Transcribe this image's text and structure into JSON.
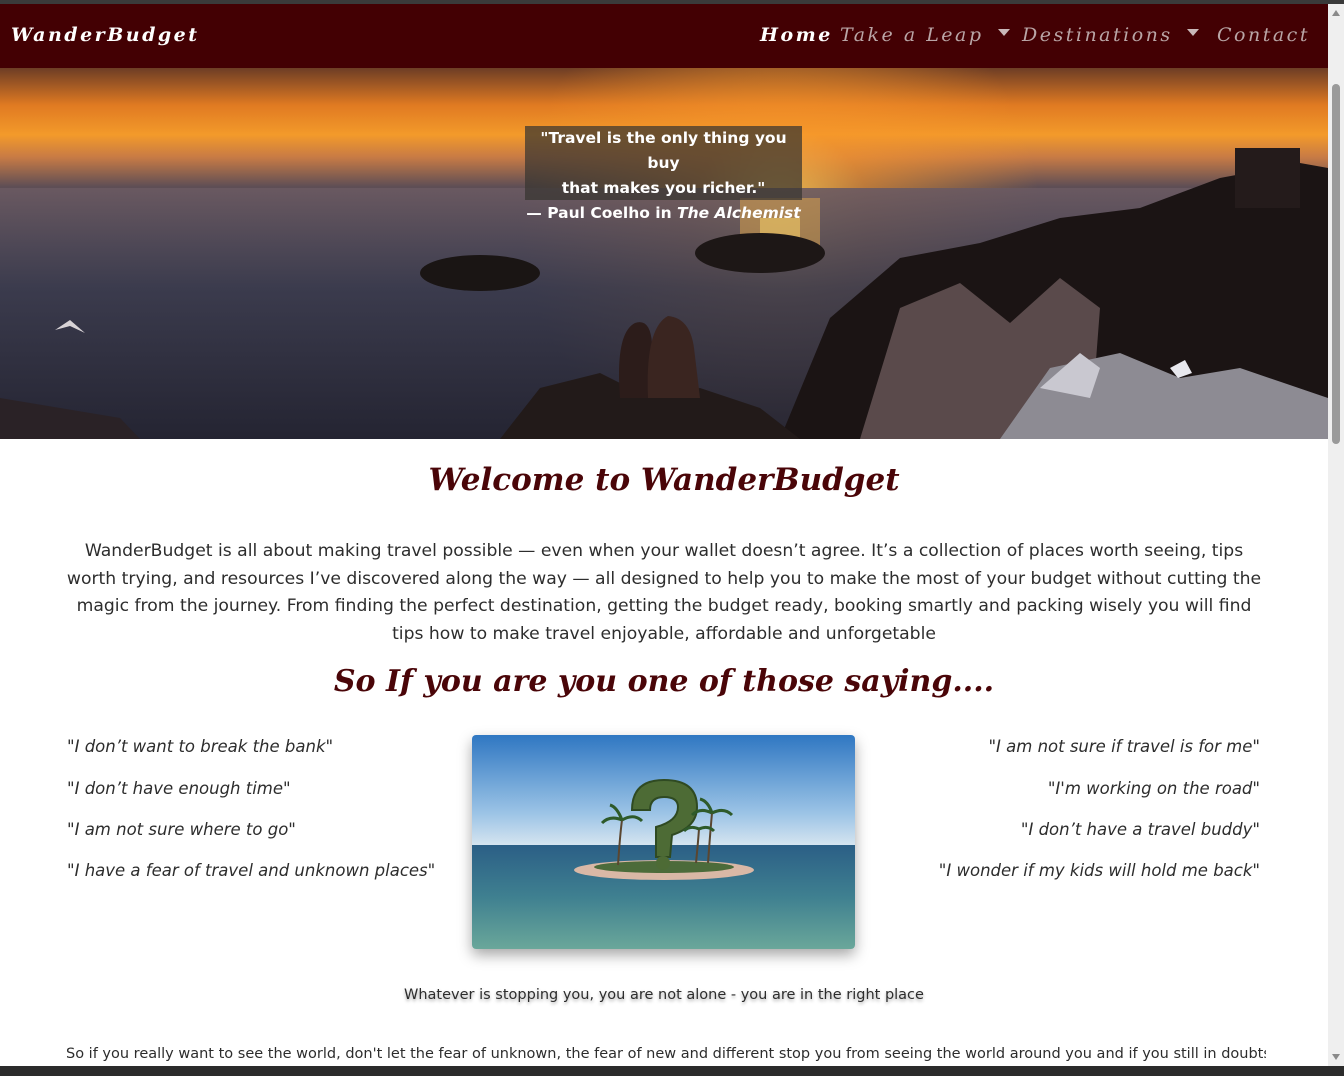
{
  "navbar": {
    "brand": "WanderBudget",
    "items": [
      {
        "label": "Home",
        "active": true
      },
      {
        "label": "Take a Leap",
        "dropdown": true
      },
      {
        "label": "Destinations",
        "dropdown": true
      },
      {
        "label": "Contact"
      }
    ]
  },
  "hero": {
    "quote_line1": "\"Travel is the only thing you buy",
    "quote_line2": "that makes you richer.\"",
    "attribution_prefix": "—  Paul Coelho in ",
    "attribution_book": "The Alchemist"
  },
  "main": {
    "title": "Welcome to WanderBudget",
    "intro": "WanderBudget is all about making travel possible — even when your wallet doesn’t agree. It’s a collection of places worth seeing, tips worth trying, and resources I’ve discovered along the way — all designed to help you to make the most of your budget without cutting the magic from the journey. From finding the perfect destination, getting the budget ready, booking smartly and packing wisely you will find tips how to make travel enjoyable, affordable and unforgetable",
    "subtitle": "So If you are you one of those saying....",
    "sayings_left": [
      "\"I don’t want to break the bank\"",
      "\"I don’t have enough time\"",
      "\"I am not sure where to go\"",
      "\"I have a fear of travel and unknown places\""
    ],
    "sayings_right": [
      "\"I am not sure if travel is for me\"",
      "\"I'm working on the road\"",
      "\"I don’t have a travel buddy\"",
      "\"I wonder if my kids will hold me back\""
    ],
    "caption": "Whatever is stopping you, you are not alone - you are in the right place",
    "closing": "So if you really want to see the world, don't let the fear of unknown, the fear of new and different stop you from seeing the world around you and if you still in doubts, see"
  },
  "colors": {
    "navbar_bg": "#430003",
    "heading": "#4a0508",
    "nav_inactive": "#b9a5a6"
  }
}
